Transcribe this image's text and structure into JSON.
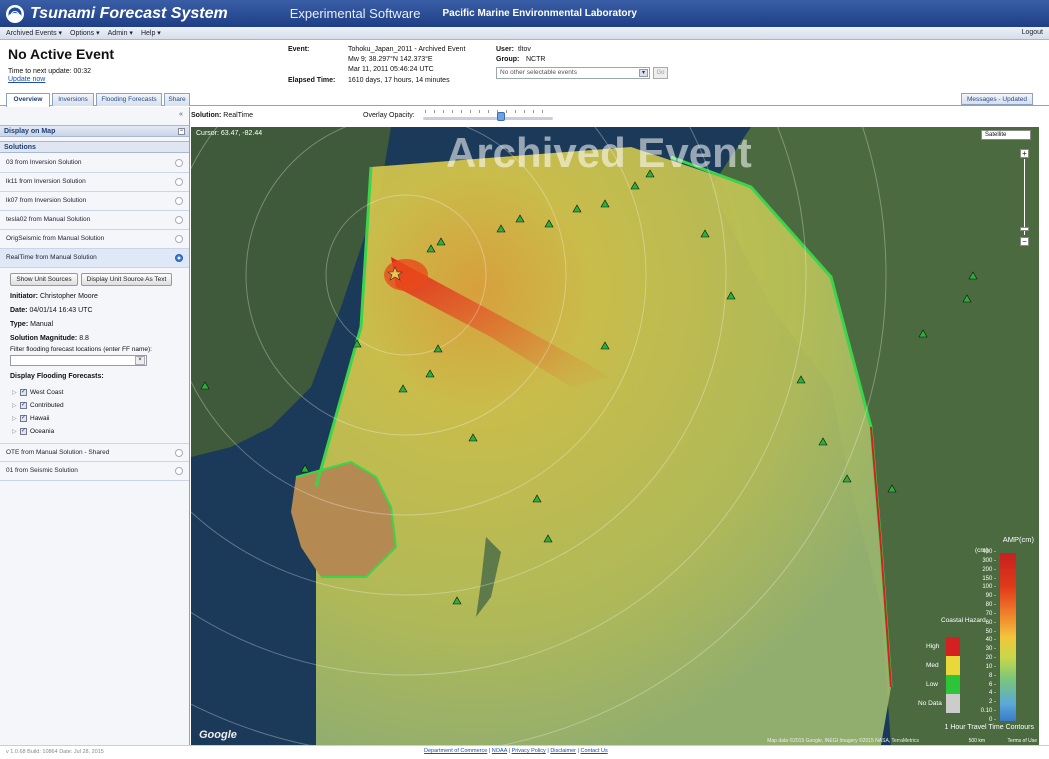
{
  "app": {
    "title": "Tsunami Forecast System",
    "subtitle": "Experimental Software",
    "lab": "Pacific Marine Environmental Laboratory"
  },
  "menu": {
    "items": [
      "Archived Events ▾",
      "Options ▾",
      "Admin ▾",
      "Help ▾"
    ],
    "logout": "Logout"
  },
  "status": {
    "heading": "No Active Event",
    "next_update": "Time to next update: 00:32",
    "update_now": "Update now"
  },
  "event": {
    "event_label": "Event:",
    "event_name": "Tohoku_Japan_2011 - Archived Event",
    "magnitude_loc": "Mw 9;  38.297°N 142.373°E",
    "datetime": "Mar 11, 2011 05:46:24 UTC",
    "elapsed_label": "Elapsed Time:",
    "elapsed": "1610 days, 17 hours, 14 minutes",
    "user_label": "User:",
    "user": "tltov",
    "group_label": "Group:",
    "group": "NCTR",
    "select_text": "No other selectable events",
    "go": "Go"
  },
  "tabs": [
    "Overview",
    "Inversions",
    "Flooding Forecasts",
    "Share"
  ],
  "messages_tab": "Messages - Updated",
  "sidebar": {
    "display_on_map": "Display on Map",
    "solutions_header": "Solutions",
    "solutions": [
      "03 from Inversion Solution",
      "lk11 from Inversion Solution",
      "lk07 from Inversion Solution",
      "tesla02 from Manual Solution",
      "OrigSeismic from Manual Solution",
      "RealTime from Manual Solution"
    ],
    "show_unit_sources": "Show Unit Sources",
    "display_unit_source_text": "Display Unit Source As Text",
    "initiator_label": "Initiator:",
    "initiator": "Christopher Moore",
    "date_label": "Date:",
    "date": "04/01/14 16:43 UTC",
    "type_label": "Type:",
    "type": "Manual",
    "magnitude_label": "Solution Magnitude:",
    "magnitude": "8.8",
    "filter_label": "Filter flooding forecast locations (enter FF name):",
    "display_ff_label": "Display Flooding Forecasts:",
    "ff_items": [
      "West Coast",
      "Contributed",
      "Hawaii",
      "Oceania"
    ],
    "more_solutions": [
      "OTE from Manual Solution - Shared",
      "01 from Seismic Solution"
    ]
  },
  "map": {
    "solution_label": "Solution:",
    "solution": "RealTime",
    "overlay_label": "Overlay Opacity:",
    "overlay_opacity_fraction": 0.6,
    "cursor": "Cursor: 63.47, -82.44",
    "watermark": "Archived Event",
    "map_type": "Satellite",
    "zoom_plus": "+",
    "zoom_minus": "−",
    "google": "Google",
    "attribution": "Map data ©2015 Google, INEGI Imagery ©2015 NASA, TerraMetrics",
    "scale": "500 km",
    "terms": "Terms of Use"
  },
  "legend": {
    "title": "AMP(cm)",
    "unit": "(cm)",
    "ticks": [
      "400",
      "300",
      "200",
      "150",
      "100",
      "90",
      "80",
      "70",
      "60",
      "50",
      "40",
      "30",
      "20",
      "10",
      "8",
      "6",
      "4",
      "2",
      "0.10",
      "0"
    ],
    "coastal_label": "Coastal Hazard",
    "coastal": [
      "High",
      "Med",
      "Low",
      "No Data"
    ],
    "contours": "1 Hour Travel Time Contours"
  },
  "colors": {
    "header_blue": "#1f3f86",
    "accent": "#3d7ad8",
    "hazard_high": "#d42020",
    "hazard_med": "#e8d83a",
    "hazard_low": "#2ec43a",
    "hazard_nodata": "#cccccc"
  },
  "footer": {
    "build": "v 1.0.68 Build: 10864 Date: Jul 28, 2015",
    "links": [
      "Department of Commerce",
      "NOAA",
      "Privacy Policy",
      "Disclaimer",
      "Contact Us"
    ]
  }
}
